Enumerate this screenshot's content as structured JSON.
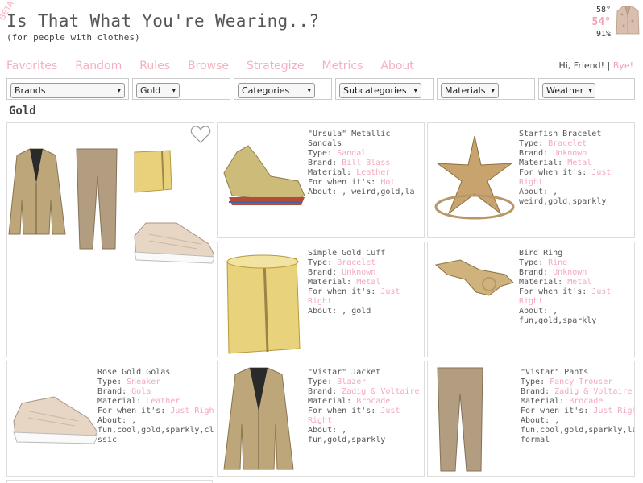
{
  "header": {
    "beta": "BETA",
    "title": "Is That What You're Wearing..?",
    "subtitle": "(for people with clothes)",
    "weather": {
      "high": "58°",
      "current": "54°",
      "humidity": "91%"
    }
  },
  "nav": {
    "items": [
      "Favorites",
      "Random",
      "Rules",
      "Browse",
      "Strategize",
      "Metrics",
      "About"
    ],
    "greeting": "Hi, Friend!",
    "separator": "|",
    "logout": "Bye!"
  },
  "filters": {
    "brands": "Brands",
    "color": "Gold",
    "categories": "Categories",
    "subcategories": "Subcategories",
    "materials": "Materials",
    "weather": "Weather"
  },
  "section_title": "Gold",
  "labels": {
    "type": "Type: ",
    "brand": "Brand: ",
    "material": "Material: ",
    "when": "For when it's: ",
    "about": "About: "
  },
  "items": [
    {
      "name": "\"Ursula\" Metallic Sandals",
      "type": "Sandal",
      "brand": "Bill Blass",
      "material": "Leather",
      "when": "Hot",
      "about": ", weird,gold,la"
    },
    {
      "name": "Starfish Bracelet",
      "type": "Bracelet",
      "brand": "Unknown",
      "material": "Metal",
      "when": "Just Right",
      "about": ",\nweird,gold,sparkly"
    },
    {
      "name": "Simple Gold Cuff",
      "type": "Bracelet",
      "brand": "Unknown",
      "material": "Metal",
      "when": "Just Right",
      "about": ", gold"
    },
    {
      "name": "Bird Ring",
      "type": "Ring",
      "brand": "Unknown",
      "material": "Metal",
      "when": "Just Right",
      "about": ", fun,gold,sparkly"
    },
    {
      "name": "Rose Gold Golas",
      "type": "Sneaker",
      "brand": "Gola",
      "material": "Leather",
      "when": "Just Right",
      "about": ",\nfun,cool,gold,sparkly,cla\nssic"
    },
    {
      "name": "\"Vistar\" Jacket",
      "type": "Blazer",
      "brand": "Zadig & Voltaire",
      "material": "Brocade",
      "when": "Just Right",
      "about": ", fun,gold,sparkly"
    },
    {
      "name": "\"Vistar\" Pants",
      "type": "Fancy Trouser",
      "brand": "Zadig & Voltaire",
      "material": "Brocade",
      "when": "Just Right",
      "about": ",\nfun,cool,gold,sparkly,la,\nformal"
    }
  ],
  "colors": {
    "accent": "#f4a8bc",
    "border": "#dddddd",
    "gold": "#c9a86a"
  }
}
